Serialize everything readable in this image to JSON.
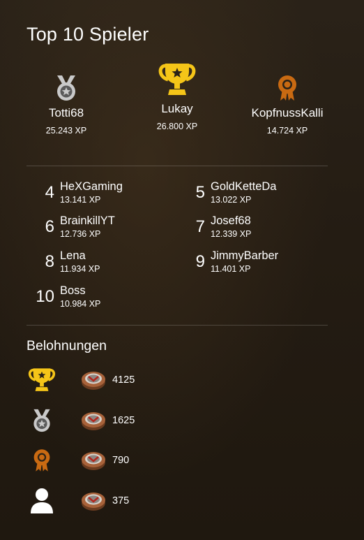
{
  "title": "Top 10 Spieler",
  "colors": {
    "gold": "#f5c518",
    "silver": "#c9c9c9",
    "bronze": "#c96a12",
    "text": "#ffffff"
  },
  "podium": [
    {
      "place": 2,
      "name": "Totti68",
      "xp": "25.243 XP",
      "icon": "silver-medal-icon"
    },
    {
      "place": 1,
      "name": "Lukay",
      "xp": "26.800 XP",
      "icon": "gold-trophy-icon"
    },
    {
      "place": 3,
      "name": "KopfnussKalli",
      "xp": "14.724 XP",
      "icon": "bronze-rosette-icon"
    }
  ],
  "ranks": [
    {
      "rank": "4",
      "name": "HeXGaming",
      "xp": "13.141 XP"
    },
    {
      "rank": "5",
      "name": "GoldKetteDa",
      "xp": "13.022 XP"
    },
    {
      "rank": "6",
      "name": "BrainkillYT",
      "xp": "12.736 XP"
    },
    {
      "rank": "7",
      "name": "Josef68",
      "xp": "12.339 XP"
    },
    {
      "rank": "8",
      "name": "Lena",
      "xp": "11.934 XP"
    },
    {
      "rank": "9",
      "name": "JimmyBarber",
      "xp": "11.401 XP"
    },
    {
      "rank": "10",
      "name": "Boss",
      "xp": "10.984 XP"
    }
  ],
  "rewards": {
    "title": "Belohnungen",
    "items": [
      {
        "icon": "gold-trophy-icon",
        "coin": "coin-icon",
        "amount": "4125"
      },
      {
        "icon": "silver-medal-icon",
        "coin": "coin-icon",
        "amount": "1625"
      },
      {
        "icon": "bronze-rosette-icon",
        "coin": "coin-icon",
        "amount": "790"
      },
      {
        "icon": "user-icon",
        "coin": "coin-icon",
        "amount": "375"
      }
    ]
  }
}
